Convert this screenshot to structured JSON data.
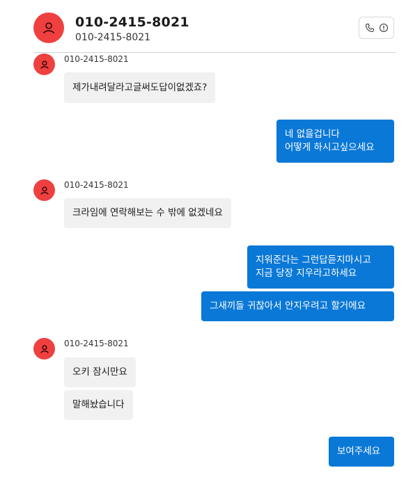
{
  "header": {
    "title": "010-2415-8021",
    "subtitle": "010-2415-8021",
    "avatar_color": "#ef4040",
    "icons": [
      "phone-icon",
      "info-icon"
    ]
  },
  "messages": [
    {
      "direction": "in",
      "sender": "010-2415-8021",
      "text": "제가내려달라고글써도답이없겠죠?"
    },
    {
      "direction": "out",
      "lines": [
        "네 없을겁니다",
        "어떻게 하시고싶으세요"
      ]
    },
    {
      "direction": "in",
      "sender": "010-2415-8021",
      "text": "크라임에 연락해보는 수 밖에 없겠네요"
    },
    {
      "direction": "out",
      "lines": [
        "지워준다는 그런답듣지마시고",
        "지금 당장 지우라고하세요"
      ]
    },
    {
      "direction": "out",
      "lines": [
        "그새끼들 귀찮아서 안지우려고 할거에요"
      ]
    },
    {
      "direction": "in",
      "sender": "010-2415-8021",
      "text": "오키 잠시만요"
    },
    {
      "direction": "in",
      "text": "말해놨습니다"
    },
    {
      "direction": "out",
      "lines": [
        "보여주세요"
      ]
    }
  ],
  "colors": {
    "outgoing_bubble": "#0a78d7",
    "incoming_bubble": "#f1f1f1",
    "avatar": "#ef4040"
  }
}
